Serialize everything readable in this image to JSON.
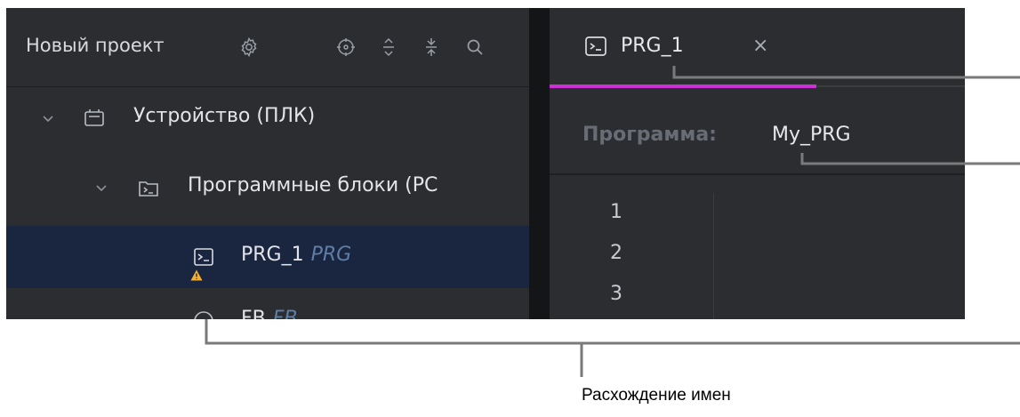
{
  "project_panel": {
    "title": "Новый проект",
    "header_icons": [
      "gear-icon",
      "locate-icon",
      "expand-icon",
      "collapse-icon",
      "search-icon"
    ],
    "tree": [
      {
        "label": "Устройство (ПЛК)",
        "icon": "device-icon",
        "expanded": true
      },
      {
        "label": "Программные блоки (РС",
        "icon": "folder-terminal-icon",
        "expanded": true
      },
      {
        "label": "PRG_1",
        "sub": "PRG",
        "icon": "terminal-icon",
        "warning": true,
        "selected": true
      },
      {
        "label": "FB",
        "sub": "FB",
        "icon": "fb-icon"
      }
    ]
  },
  "editor": {
    "tab": {
      "label": "PRG_1",
      "close": "×",
      "icon": "terminal-icon"
    },
    "declaration": {
      "keyword": "Программа:",
      "name": "My_PRG"
    },
    "line_numbers": [
      "1",
      "2",
      "3"
    ]
  },
  "annotation": {
    "caption": "Расхождение имен"
  },
  "colors": {
    "panel_bg": "#2b2d30",
    "selected_row": "#1a2540",
    "tab_underline": "#cf2fd6",
    "warning": "#f2b134",
    "callout_line": "#7a7a7a"
  }
}
